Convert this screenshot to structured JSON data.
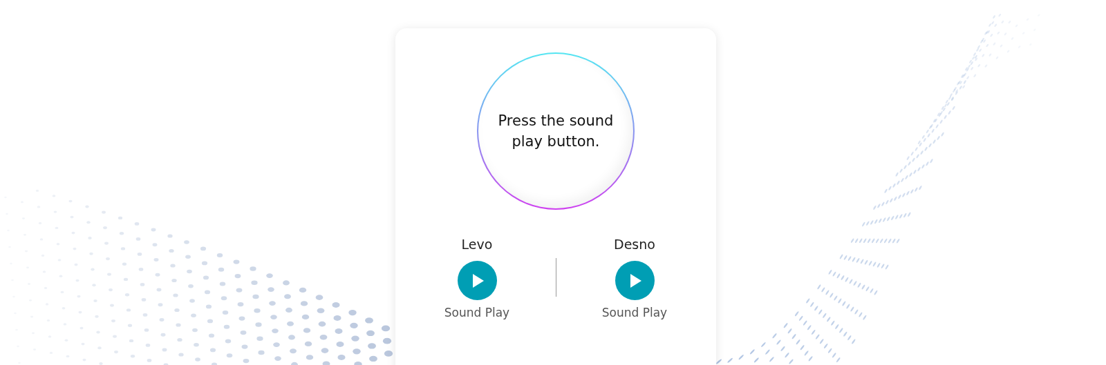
{
  "prompt": "Press the sound play button.",
  "channels": [
    {
      "label": "Levo",
      "caption": "Sound Play"
    },
    {
      "label": "Desno",
      "caption": "Sound Play"
    }
  ]
}
